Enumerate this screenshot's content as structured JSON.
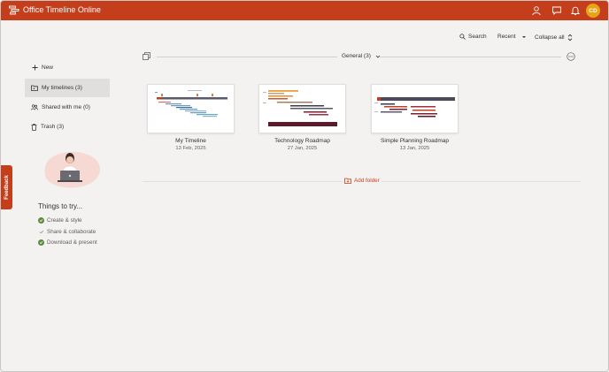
{
  "app": {
    "title": "Office Timeline Online",
    "avatar_initials": "CD",
    "accent_color": "#c43e1c"
  },
  "toolbar": {
    "search_label": "Search",
    "sort_label": "Recent",
    "collapse_label": "Collapse all"
  },
  "sidebar": {
    "new_label": "New",
    "items": [
      {
        "label": "My timelines (3)",
        "icon": "folder-icon",
        "active": true
      },
      {
        "label": "Shared with me (0)",
        "icon": "people-icon",
        "active": false
      },
      {
        "label": "Trash (3)",
        "icon": "trash-icon",
        "active": false
      }
    ]
  },
  "things": {
    "title": "Things to try...",
    "items": [
      {
        "label": "Create & style",
        "done": true
      },
      {
        "label": "Share & collaborate",
        "done": false
      },
      {
        "label": "Download & present",
        "done": true
      }
    ]
  },
  "feedback_label": "Feedback",
  "section": {
    "label": "General (3)"
  },
  "timelines": [
    {
      "title": "My Timeline",
      "date": "13 Feb, 2025"
    },
    {
      "title": "Technology Roadmap",
      "date": "27 Jan, 2025"
    },
    {
      "title": "Simple Planning Roadmap",
      "date": "13 Jan, 2025"
    }
  ],
  "add_folder_label": "Add folder"
}
